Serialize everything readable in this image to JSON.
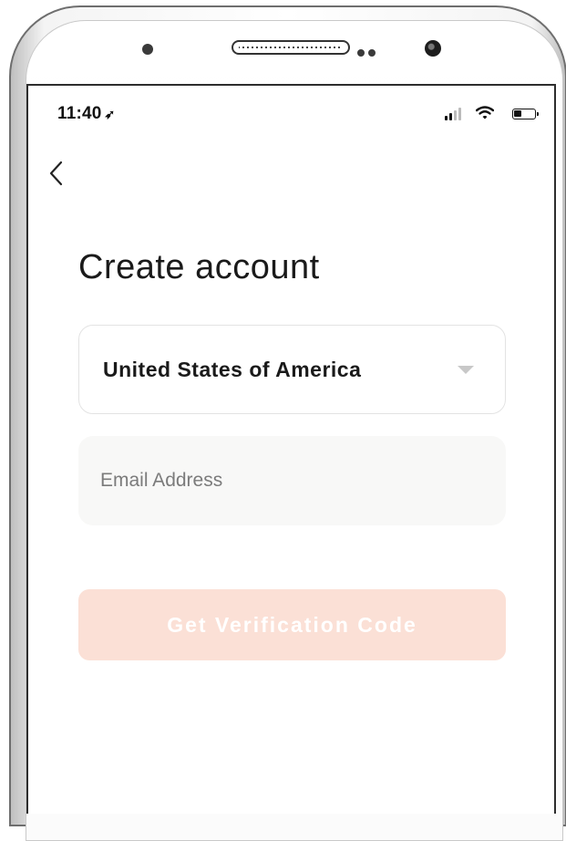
{
  "status_bar": {
    "time": "11:40",
    "location_icon": "location-arrow-icon",
    "signal_icon": "signal-icon",
    "wifi_icon": "wifi-icon",
    "battery_icon": "battery-icon"
  },
  "nav": {
    "back_icon": "chevron-left-icon"
  },
  "page": {
    "title": "Create account"
  },
  "form": {
    "country_value": "United States of America",
    "country_caret_icon": "caret-down-icon",
    "email_placeholder": "Email Address",
    "email_value": "",
    "submit_label": "Get Verification Code"
  },
  "colors": {
    "accent_disabled": "#fbe0d6",
    "input_bg": "#f8f8f7",
    "border": "#e3e3e3"
  }
}
